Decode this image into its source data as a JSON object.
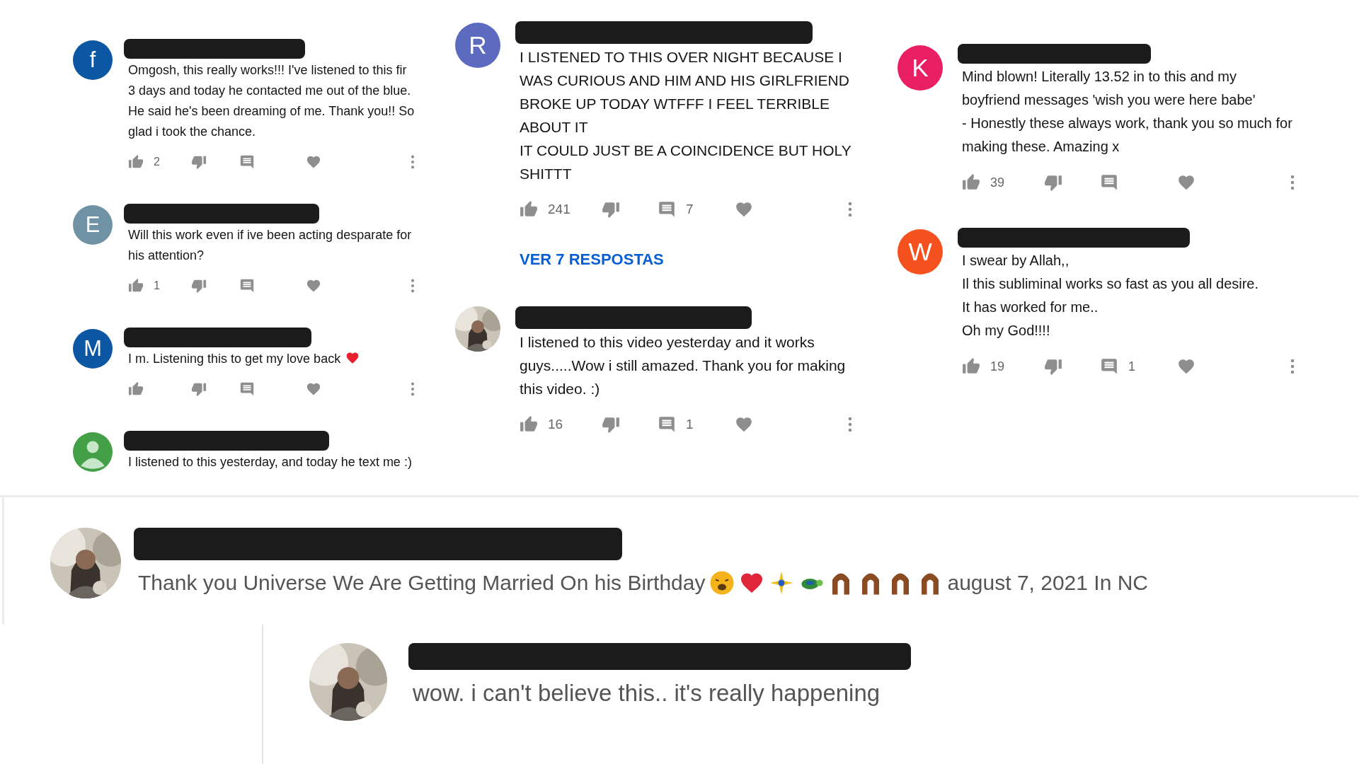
{
  "columns": [
    {
      "comments": [
        {
          "avatar": {
            "kind": "letter",
            "letter": "f",
            "color": "#0b57a4"
          },
          "text": "Omgosh, this really works!!! I've listened to this fir 3 days and today he contacted me out of the blue. He said he's been dreaming of me. Thank you!! So glad i took the chance.",
          "show_actions": true,
          "likes": "2"
        },
        {
          "avatar": {
            "kind": "letter",
            "letter": "E",
            "color": "#6f93a5"
          },
          "text": "Will this work even if ive been acting desparate for his attention?",
          "show_actions": true,
          "likes": "1"
        },
        {
          "avatar": {
            "kind": "letter",
            "letter": "M",
            "color": "#0b57a4"
          },
          "text": "I m. Listening this to get my love back",
          "heart_emoji": true,
          "show_actions": true
        },
        {
          "avatar": {
            "kind": "default",
            "color": "#43a047"
          },
          "text": "I listened to this yesterday, and today he text me :)",
          "show_actions": false
        }
      ]
    },
    {
      "comments": [
        {
          "avatar": {
            "kind": "letter",
            "letter": "R",
            "color": "#5c6bc0"
          },
          "text": "I LISTENED TO THIS OVER NIGHT BECAUSE I WAS CURIOUS AND HIM AND HIS GIRLFRIEND BROKE UP TODAY WTFFF I FEEL TERRIBLE ABOUT IT\nIT COULD JUST BE A COINCIDENCE BUT HOLY SHITTT",
          "show_actions": true,
          "likes": "241",
          "replies": "7",
          "more_link": "VER 7 RESPOSTAS"
        },
        {
          "text": "I listened to this video yesterday and it works guys.....Wow i still amazed. Thank you for making this video. :)",
          "show_actions": true,
          "likes": "16",
          "replies": "1"
        }
      ]
    },
    {
      "comments": [
        {
          "avatar": {
            "kind": "letter",
            "letter": "K",
            "color": "#e91e63"
          },
          "text": "Mind blown! Literally 13.52 in to this and my boyfriend messages 'wish you were here babe'\n- Honestly these always work, thank you so much for making these.  Amazing x",
          "show_actions": true,
          "likes": "39"
        },
        {
          "avatar": {
            "kind": "letter",
            "letter": "W",
            "color": "#f4511e"
          },
          "text": "I swear by Allah,,\nIl this subliminal works so fast as you all desire.\nIt has worked for me..\nOh my God!!!!",
          "show_actions": true,
          "likes": "19",
          "replies": "1"
        }
      ]
    }
  ],
  "featured": {
    "text": "Thank you Universe We Are Getting Married On his Birthday",
    "emojis": [
      {
        "kind": "weary-face"
      },
      {
        "kind": "heart"
      },
      {
        "kind": "sparkle"
      },
      {
        "kind": "turtle"
      },
      {
        "kind": "hands"
      },
      {
        "kind": "hands"
      },
      {
        "kind": "hands"
      },
      {
        "kind": "hands"
      }
    ],
    "text_after": "august 7, 2021 In NC",
    "reply": {
      "text": "wow. i can't believe this.. it's really happening"
    }
  }
}
